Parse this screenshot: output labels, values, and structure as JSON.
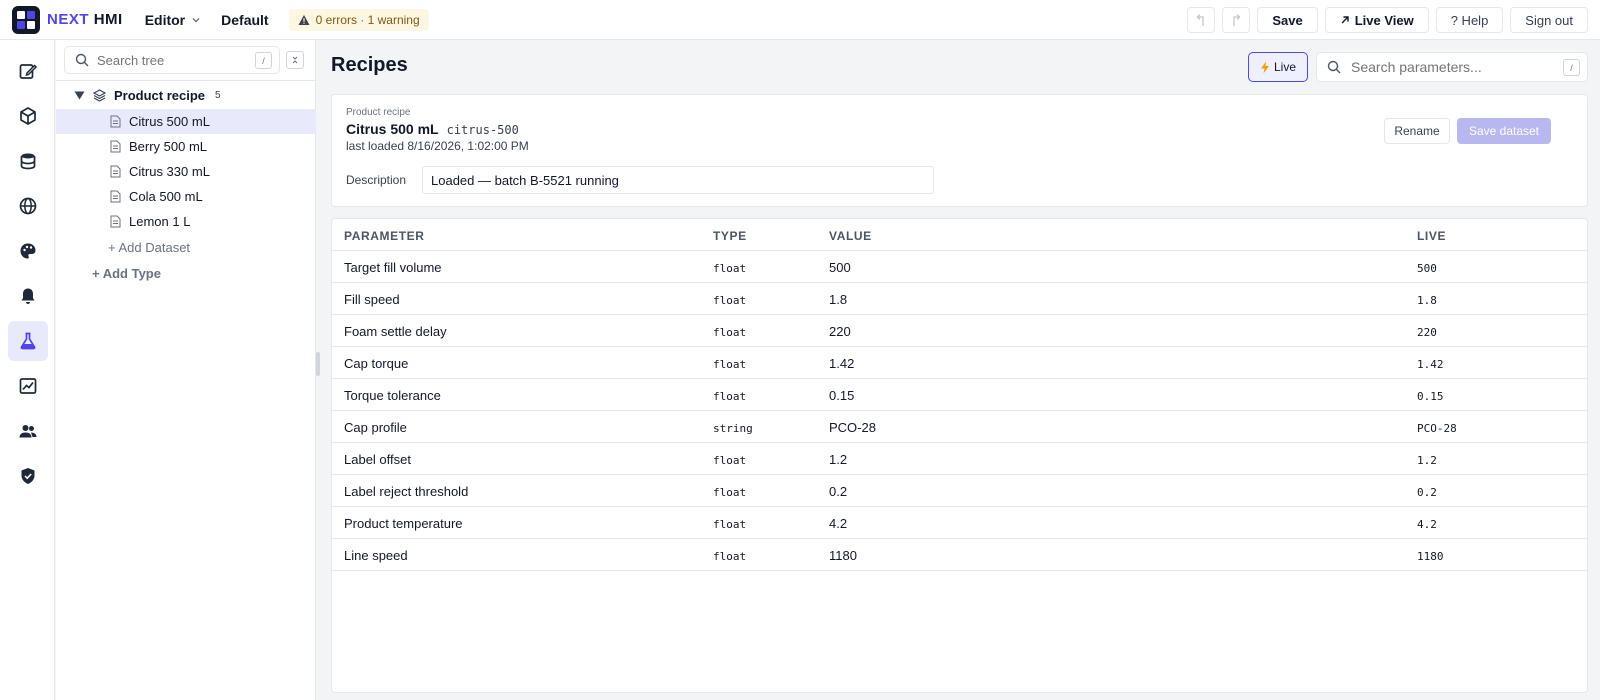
{
  "brand": {
    "name_part1": "NEXT",
    "name_part2": "HMI",
    "accent": "#4f46e5"
  },
  "menu": {
    "editor": "Editor",
    "project": "Default"
  },
  "status": {
    "text": "0 errors · 1 warning"
  },
  "actions": {
    "save": "Save",
    "live_view": "Live View",
    "help": "? Help",
    "sign_out": "Sign out"
  },
  "tree": {
    "search_placeholder": "Search tree",
    "shortcut": "/",
    "root_label": "Product recipe",
    "root_count": "5",
    "items": [
      {
        "label": "Citrus 500 mL"
      },
      {
        "label": "Berry 500 mL"
      },
      {
        "label": "Citrus 330 mL"
      },
      {
        "label": "Cola 500 mL"
      },
      {
        "label": "Lemon 1 L"
      }
    ],
    "add_dataset": "+ Add Dataset",
    "add_type": "+ Add Type"
  },
  "main": {
    "title": "Recipes",
    "live_toggle": "Live",
    "param_search_placeholder": "Search parameters...",
    "shortcut": "/",
    "dataset": {
      "breadcrumb": "Product recipe",
      "name": "Citrus 500 mL",
      "slug": "citrus-500",
      "loaded": "last loaded 8/16/2026, 1:02:00 PM",
      "description_label": "Description",
      "description_value": "Loaded — batch B-5521 running",
      "rename": "Rename",
      "save_dataset": "Save dataset"
    },
    "table": {
      "headers": [
        "PARAMETER",
        "TYPE",
        "VALUE",
        "LIVE"
      ],
      "rows": [
        {
          "parameter": "Target fill volume",
          "type": "float",
          "value": "500",
          "live": "500"
        },
        {
          "parameter": "Fill speed",
          "type": "float",
          "value": "1.8",
          "live": "1.8"
        },
        {
          "parameter": "Foam settle delay",
          "type": "float",
          "value": "220",
          "live": "220"
        },
        {
          "parameter": "Cap torque",
          "type": "float",
          "value": "1.42",
          "live": "1.42"
        },
        {
          "parameter": "Torque tolerance",
          "type": "float",
          "value": "0.15",
          "live": "0.15"
        },
        {
          "parameter": "Cap profile",
          "type": "string",
          "value": "PCO-28",
          "live": "PCO-28"
        },
        {
          "parameter": "Label offset",
          "type": "float",
          "value": "1.2",
          "live": "1.2"
        },
        {
          "parameter": "Label reject threshold",
          "type": "float",
          "value": "0.2",
          "live": "0.2"
        },
        {
          "parameter": "Product temperature",
          "type": "float",
          "value": "4.2",
          "live": "4.2"
        },
        {
          "parameter": "Line speed",
          "type": "float",
          "value": "1180",
          "live": "1180"
        }
      ]
    }
  },
  "rail": [
    {
      "icon": "edit-icon"
    },
    {
      "icon": "cube-icon"
    },
    {
      "icon": "database-icon"
    },
    {
      "icon": "globe-icon"
    },
    {
      "icon": "palette-icon"
    },
    {
      "icon": "bell-icon"
    },
    {
      "icon": "flask-icon"
    },
    {
      "icon": "chart-icon"
    },
    {
      "icon": "users-icon"
    },
    {
      "icon": "shield-icon"
    }
  ]
}
